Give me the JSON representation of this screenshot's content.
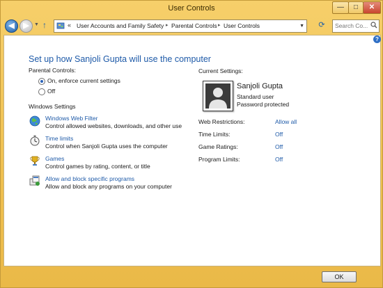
{
  "window": {
    "title": "User Controls"
  },
  "address": {
    "prefix": "«",
    "crumbs": [
      "User Accounts and Family Safety",
      "Parental Controls",
      "User Controls"
    ]
  },
  "search": {
    "placeholder": "Search Co..."
  },
  "heading": "Set up how Sanjoli Gupta will use the computer",
  "parental": {
    "label": "Parental Controls:",
    "options": [
      {
        "label": "On, enforce current settings",
        "selected": true
      },
      {
        "label": "Off",
        "selected": false
      }
    ]
  },
  "windows_settings": {
    "label": "Windows Settings",
    "items": [
      {
        "icon": "globe-icon",
        "link": "Windows Web Filter",
        "desc": "Control allowed websites, downloads, and other use"
      },
      {
        "icon": "stopwatch-icon",
        "link": "Time limits",
        "desc": "Control when Sanjoli Gupta uses the computer"
      },
      {
        "icon": "trophy-icon",
        "link": "Games",
        "desc": "Control games by rating, content, or title"
      },
      {
        "icon": "programs-icon",
        "link": "Allow and block specific programs",
        "desc": "Allow and block any programs on your computer"
      }
    ]
  },
  "current_settings": {
    "label": "Current Settings:",
    "user": {
      "name": "Sanjoli Gupta",
      "type": "Standard user",
      "password": "Password protected"
    },
    "rows": [
      {
        "label": "Web Restrictions:",
        "value": "Allow all"
      },
      {
        "label": "Time Limits:",
        "value": "Off"
      },
      {
        "label": "Game Ratings:",
        "value": "Off"
      },
      {
        "label": "Program Limits:",
        "value": "Off"
      }
    ]
  },
  "buttons": {
    "ok": "OK",
    "minimize": "—",
    "maximize": "□",
    "close": "✕",
    "help": "?"
  },
  "colors": {
    "link": "#1e5aa8",
    "frame": "#efc050",
    "heading": "#1e5aa8"
  }
}
